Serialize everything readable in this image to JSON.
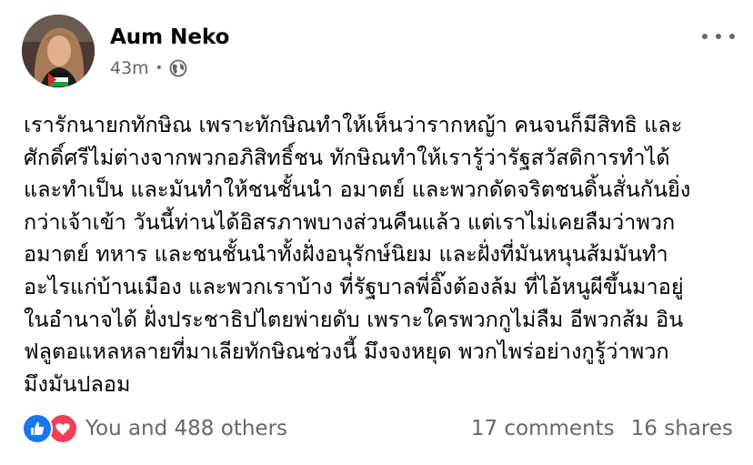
{
  "post": {
    "author": "Aum Neko",
    "time": "43m",
    "privacy_icon": "globe-icon",
    "body_lines": [
      "เรารักนายกทักษิณ เพราะทักษิณทำให้เห็นว่ารากหญ้า คนจนก็มีสิทธิ และ",
      "ศักดิ์ศรีไม่ต่างจากพวกอภิสิทธิ์ชน ทักษิณทำให้เรารู้ว่ารัฐสวัสดิการทำได้",
      "และทำเป็น และมันทำให้ชนชั้นนำ อมาตย์ และพวกดัดจริตชนดิ้นสั่นกันยิ่ง",
      "กว่าเจ้าเข้า วันนี้ท่านได้อิสรภาพบางส่วนคืนแล้ว แต่เราไม่เคยลืมว่าพวก",
      "อมาตย์ ทหาร และชนชั้นนำทั้งฝั่งอนุรักษ์นิยม และฝั่งที่มันหนุนส้มมันทำ",
      "อะไรแก่บ้านเมือง และพวกเราบ้าง ที่รัฐบาลพี่อิ๊งต้องล้ม ที่ไอ้หนูผีขึ้นมาอยู่",
      "ในอำนาจได้ ฝั่งประชาธิปไตยพ่ายดับ เพราะใครพวกกูไม่ลืม อีพวกส้ม อิน",
      "ฟลูตอแหลหลายที่มาเลียทักษิณช่วงนี้ มึงจงหยุด พวกไพร่อย่างกูรู้ว่าพวก",
      "มึงมันปลอม"
    ]
  },
  "footer": {
    "reactions_text": "You and 488 others",
    "comments": "17 comments",
    "shares": "16 shares",
    "reaction_icons": [
      "like-icon",
      "love-icon"
    ]
  },
  "colors": {
    "secondary_text": "#65676b",
    "like_blue": "#1877f2",
    "love_red": "#f33e58"
  }
}
